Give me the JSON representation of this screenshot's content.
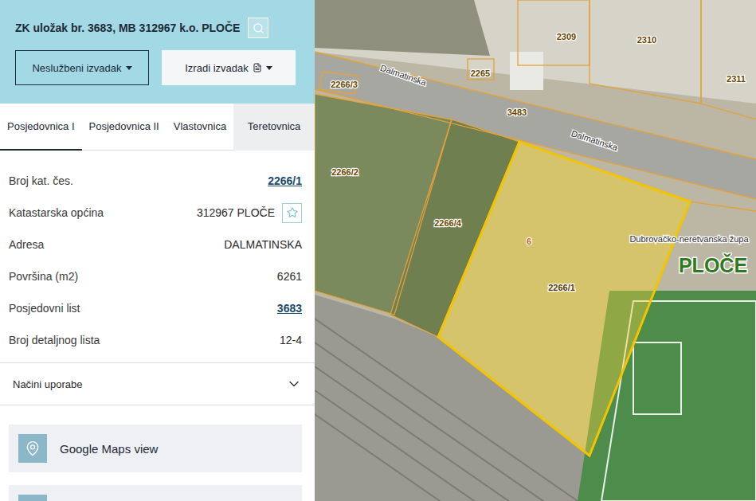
{
  "header": {
    "title": "ZK uložak br. 3683, MB 312967 k.o. PLOČE"
  },
  "buttons": [
    {
      "label": "Neslužbeni izvadak",
      "kind": "outline"
    },
    {
      "label": "Izradi izvadak",
      "kind": "filled"
    }
  ],
  "tabs": [
    {
      "label": "Posjedovnica I",
      "selected": true
    },
    {
      "label": "Posjedovnica II",
      "selected": false
    },
    {
      "label": "Vlastovnica",
      "selected": false
    },
    {
      "label": "Teretovnica",
      "selected": false
    }
  ],
  "fields": [
    {
      "label": "Broj kat. čes.",
      "value": "2266/1",
      "kind": "link"
    },
    {
      "label": "Katastarska općina",
      "value": "312967 PLOČE",
      "kind": "favorite"
    },
    {
      "label": "Adresa",
      "value": "DALMATINSKA",
      "kind": "text"
    },
    {
      "label": "Površina (m2)",
      "value": "6261",
      "kind": "text"
    },
    {
      "label": "Posjedovni list",
      "value": "3683",
      "kind": "link"
    },
    {
      "label": "Broj detaljnog lista",
      "value": "12-4",
      "kind": "text"
    }
  ],
  "accordion": {
    "label": "Načini uporabe",
    "expanded": false
  },
  "cards": [
    {
      "label": "Google Maps view"
    },
    {
      "label": ""
    }
  ],
  "map": {
    "labels": [
      {
        "text": "2309",
        "kind": "parcel",
        "selected": false
      },
      {
        "text": "2310",
        "kind": "parcel",
        "selected": false
      },
      {
        "text": "2311",
        "kind": "parcel",
        "selected": false
      },
      {
        "text": "2265",
        "kind": "parcel",
        "selected": false
      },
      {
        "text": "2266/3",
        "kind": "parcel",
        "selected": false
      },
      {
        "text": "Dalmatinska",
        "kind": "street",
        "selected": false
      },
      {
        "text": "3483",
        "kind": "parcel",
        "selected": false
      },
      {
        "text": "Dalmatinska",
        "kind": "street",
        "selected": false
      },
      {
        "text": "2266/2",
        "kind": "parcel",
        "selected": false
      },
      {
        "text": "2266/4",
        "kind": "parcel",
        "selected": false
      },
      {
        "text": "6",
        "kind": "number",
        "selected": false
      },
      {
        "text": "2266/1",
        "kind": "parcel",
        "selected": true
      },
      {
        "text": "Dubrovačko-neretvanska župa",
        "kind": "region",
        "selected": false
      },
      {
        "text": "PLOČE",
        "kind": "town",
        "selected": false
      }
    ]
  }
}
